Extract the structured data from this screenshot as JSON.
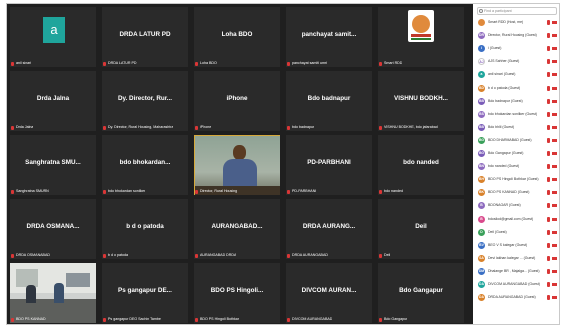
{
  "tiles": [
    {
      "name": "",
      "label": "anil sinari",
      "kind": "avatar-letter",
      "letter": "a"
    },
    {
      "name": "DRDA LATUR PD",
      "label": "DRDA LATUR PD"
    },
    {
      "name": "Loha BDO",
      "label": "Loha BDO"
    },
    {
      "name": "panchayat samit...",
      "label": "panchayat samiti umri"
    },
    {
      "name": "",
      "label": "Smart RDD",
      "kind": "logo"
    },
    {
      "name": "Drda Jalna",
      "label": "Drda Jalna"
    },
    {
      "name": "Dy. Director, Rur...",
      "label": "Dy. Director, Rural Housing, Maharashtra"
    },
    {
      "name": "iPhone",
      "label": "iPhone"
    },
    {
      "name": "Bdo badnapur",
      "label": "bdo badnapur"
    },
    {
      "name": "VISHNU BODKH...",
      "label": "VISHNU BODKHE, bdo jafarabad"
    },
    {
      "name": "Sanghratna SMU...",
      "label": "Sanghratna SMURN"
    },
    {
      "name": "bdo bhokardan...",
      "label": "bdo bhokardan sonilker"
    },
    {
      "name": "",
      "label": "Director, Rural Housing",
      "kind": "video-person"
    },
    {
      "name": "PD-PARBHANI",
      "label": "PD-PARBHANI"
    },
    {
      "name": "bdo nanded",
      "label": "bdo nanded"
    },
    {
      "name": "DRDA   OSMANA...",
      "label": "DRDA OSMANABAD"
    },
    {
      "name": "b d o patoda",
      "label": "b d o patoda"
    },
    {
      "name": "AURANGABAD...",
      "label": "AURANGABAD DRDA"
    },
    {
      "name": "DRDA  AURANG...",
      "label": "DRDA AURANGABAD"
    },
    {
      "name": "Deil",
      "label": "Deil"
    },
    {
      "name": "",
      "label": "BDO PS KANNAD",
      "kind": "video-room"
    },
    {
      "name": "Ps gangapur DE...",
      "label": "Ps gangapur DEO Sachin Tambe"
    },
    {
      "name": "BDO PS Hingoli...",
      "label": "BDO PS Hingoli Bothkar"
    },
    {
      "name": "DIVCOM  AURAN...",
      "label": "DIVCOM AURANGABAD"
    },
    {
      "name": "Bdo Gangapur",
      "label": "Bdo Gangapur"
    }
  ],
  "panel": {
    "search_placeholder": "Find a participant",
    "participants": [
      {
        "initials": "",
        "name": "Smart RDD (Host, me)",
        "color": "#e08a3c"
      },
      {
        "initials": "DR",
        "name": "Director, Rural Housing (Guest)",
        "color": "#8e6bbf"
      },
      {
        "initials": "i",
        "name": "i (Guest)",
        "color": "#3a6fc4"
      },
      {
        "initials": "AJ",
        "name": "AJS Sahher (Guest)",
        "color": "#ffffff"
      },
      {
        "initials": "a",
        "name": "anil sinari (Guest)",
        "color": "#1fa59c"
      },
      {
        "initials": "BD",
        "name": "b d o patoda (Guest)",
        "color": "#d9822b"
      },
      {
        "initials": "BB",
        "name": "Bdo badnapur (Guest)",
        "color": "#7a5cb8"
      },
      {
        "initials": "BS",
        "name": "bdo bhokardan sonilker (Guest)",
        "color": "#8e6bbf"
      },
      {
        "initials": "BB",
        "name": "Bdo bhlil (Guest)",
        "color": "#7a5cb8"
      },
      {
        "initials": "BG",
        "name": "BDO DHARMABAD (Guest)",
        "color": "#3aa05a"
      },
      {
        "initials": "BG",
        "name": "Bdo Gangapur (Guest)",
        "color": "#7a5cb8"
      },
      {
        "initials": "BN",
        "name": "bdo nanded (Guest)",
        "color": "#8e6bbf"
      },
      {
        "initials": "BH",
        "name": "BDO PS Hingoli Bothkar (Guest)",
        "color": "#d9822b"
      },
      {
        "initials": "BK",
        "name": "BDO PS KANNAD (Guest)",
        "color": "#d9822b"
      },
      {
        "initials": "B",
        "name": "BDONAGAR (Guest)",
        "color": "#8e6bbf"
      },
      {
        "initials": "B",
        "name": "bdosilod@gmail.com (Guest)",
        "color": "#d94a8c"
      },
      {
        "initials": "D",
        "name": "Deil (Guest)",
        "color": "#3aa05a"
      },
      {
        "initials": "BV",
        "name": "BEO V S kalegar (Guest)",
        "color": "#3a6fc4"
      },
      {
        "initials": "SA",
        "name": "Devi lakhan kalegar ... (Guest)",
        "color": "#d9822b"
      },
      {
        "initials": "DM",
        "name": "Dhalange BR , Majalga... (Guest)",
        "color": "#3a6fc4"
      },
      {
        "initials": "DA",
        "name": "DIVCOM AURANGABAD (Guest)",
        "color": "#1fa59c"
      },
      {
        "initials": "DA",
        "name": "DRDA AURANGABAD (Guest)",
        "color": "#d9822b"
      }
    ]
  }
}
